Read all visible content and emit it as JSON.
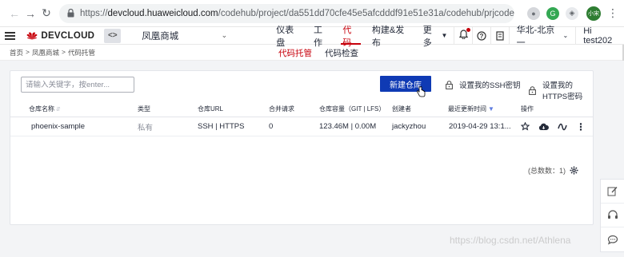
{
  "browser": {
    "url_prefix": "https://",
    "url_host": "devcloud.huaweicloud.com",
    "url_path": "/codehub/project/da551dd70cfe45e5afcdddf91e51e31a/codehub/prjcode",
    "avatar_text": "小宋"
  },
  "header": {
    "brand": "DEVCLOUD",
    "project_switch": "<>",
    "project_name": "凤凰商城",
    "nav": [
      {
        "label": "仪表盘"
      },
      {
        "label": "工作"
      },
      {
        "label": "代码",
        "active": true
      },
      {
        "label": "构建&发布"
      },
      {
        "label": "更多"
      }
    ],
    "region": "华北-北京一",
    "user": "Hi test202"
  },
  "subnav": {
    "breadcrumbs": [
      "首页",
      ">",
      "凤凰商城",
      ">",
      "代码托管"
    ],
    "tabs": [
      {
        "label": "代码托管",
        "active": true
      },
      {
        "label": "代码检查"
      }
    ]
  },
  "toolbar": {
    "search_placeholder": "请输入关键字，按enter...",
    "new_repo": "新建仓库",
    "ssh_key": "设置我的SSH密钥",
    "https_pwd": "设置我的HTTPS密码"
  },
  "table": {
    "columns": [
      "仓库名称",
      "类型",
      "仓库URL",
      "合并请求",
      "仓库容量（GIT | LFS）",
      "创建者",
      "最近更新时间",
      "操作"
    ],
    "rows": [
      {
        "name": "phoenix-sample",
        "type": "私有",
        "url": "SSH | HTTPS",
        "merge_requests": "0",
        "capacity": "123.46M  |  0.00M",
        "creator": "jackyzhou",
        "updated": "2019-04-29 13:1..."
      }
    ],
    "total": "(总数数：1)"
  },
  "watermark": "https://blog.csdn.net/Athlena",
  "colors": {
    "brand_red": "#c7000b",
    "primary_blue": "#0f3ab4",
    "link_blue": "#5e7ce0"
  }
}
